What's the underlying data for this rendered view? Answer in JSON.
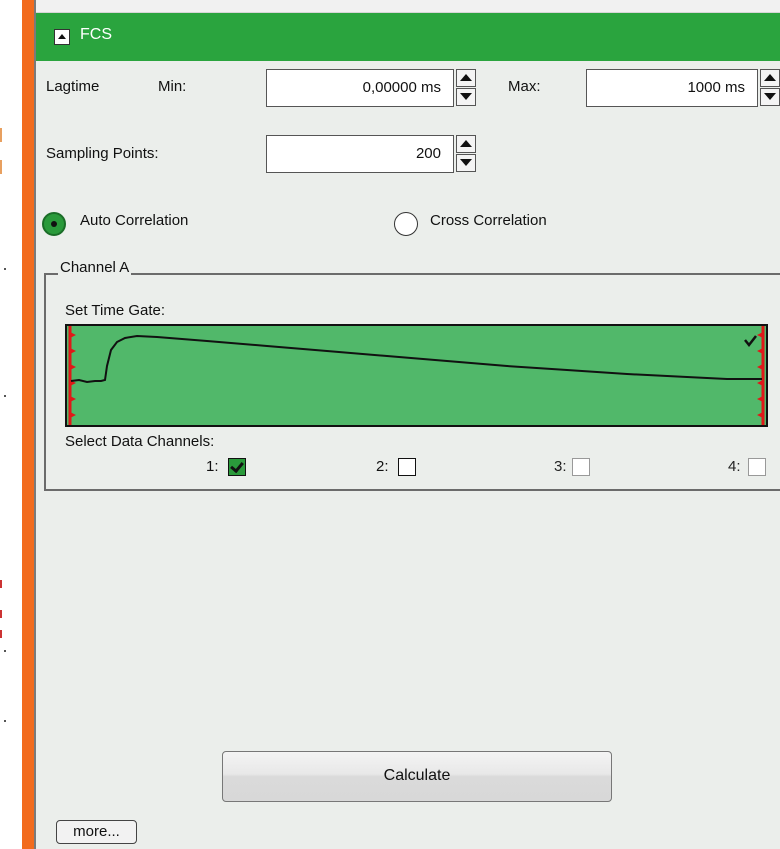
{
  "panel": {
    "title": "FCS",
    "colors": {
      "header": "#2aa43e",
      "accent_orange": "#f26b1d",
      "gate_fill": "#51b86a"
    }
  },
  "lagtime": {
    "label": "Lagtime",
    "min_label": "Min:",
    "min_value": "0,00000 ms",
    "max_label": "Max:",
    "max_value": "1000 ms"
  },
  "sampling": {
    "label": "Sampling Points:",
    "value": "200"
  },
  "correlation": {
    "auto_label": "Auto Correlation",
    "cross_label": "Cross Correlation",
    "selected": "auto"
  },
  "channel_a": {
    "group_label": "Channel A",
    "time_gate_label": "Set Time Gate:",
    "data_channels_label": "Select Data Channels:",
    "channels": [
      {
        "label": "1:",
        "state": "checked"
      },
      {
        "label": "2:",
        "state": "unchecked"
      },
      {
        "label": "3:",
        "state": "disabled"
      },
      {
        "label": "4:",
        "state": "disabled"
      }
    ]
  },
  "actions": {
    "calculate_label": "Calculate",
    "more_label": "more..."
  }
}
